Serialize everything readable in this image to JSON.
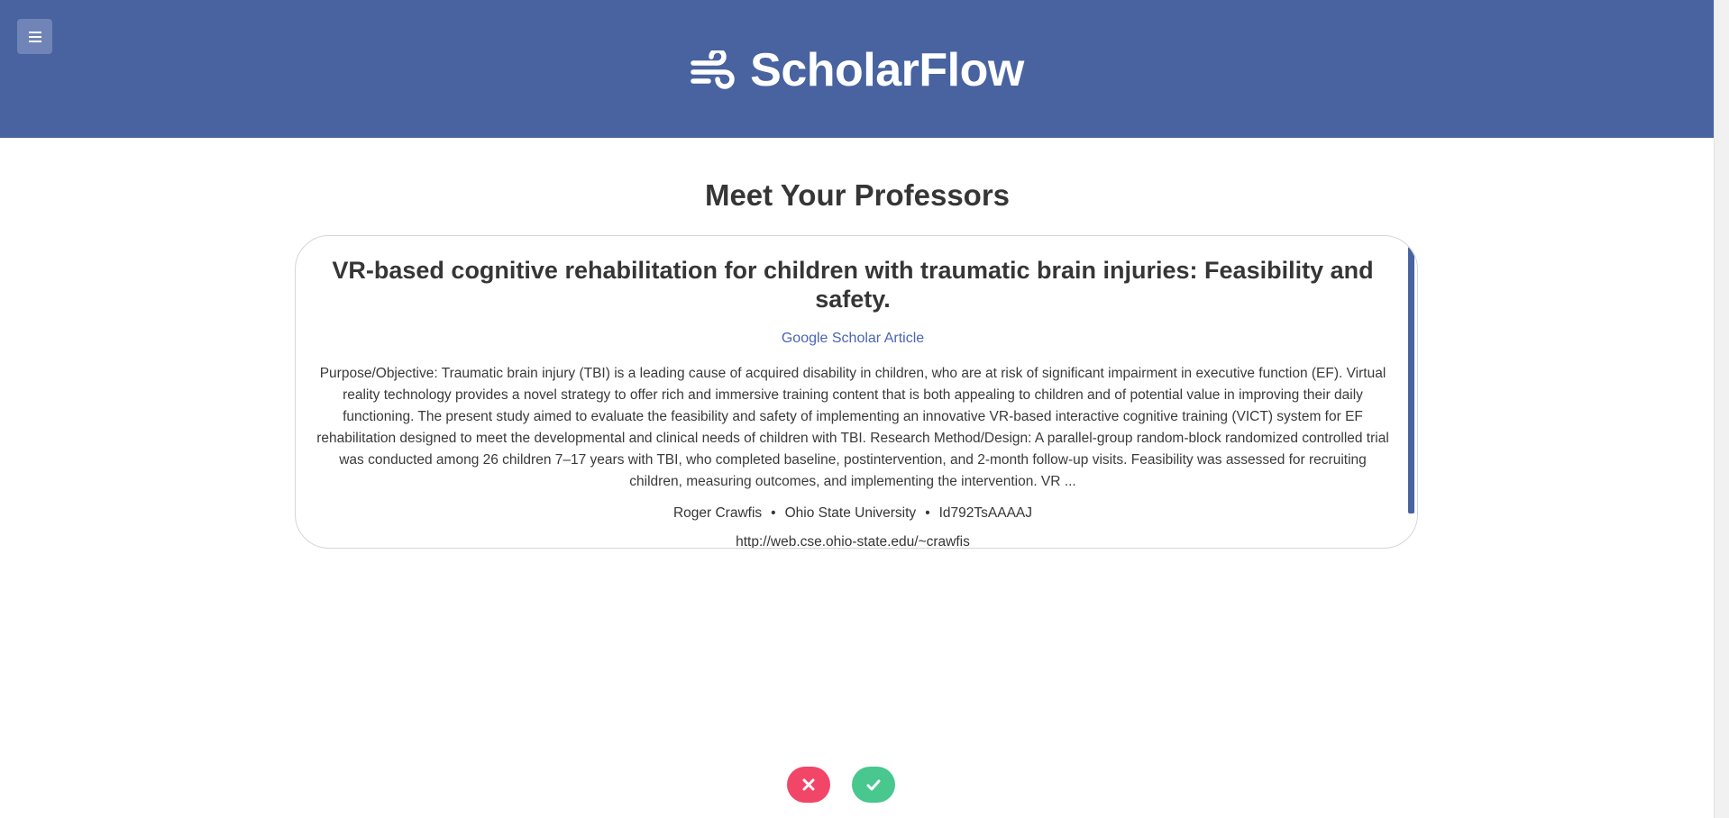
{
  "app": {
    "name": "ScholarFlow",
    "logo_icon": "wind-icon",
    "menu_icon": "hamburger-menu-icon",
    "header_color": "#4863a0"
  },
  "page": {
    "title": "Meet Your Professors"
  },
  "card": {
    "title": "VR-based cognitive rehabilitation for children with traumatic brain injuries: Feasibility and safety.",
    "link_label": "Google Scholar Article",
    "abstract": "Purpose/Objective: Traumatic brain injury (TBI) is a leading cause of acquired disability in children, who are at risk of significant impairment in executive function (EF). Virtual reality technology provides a novel strategy to offer rich and immersive training content that is both appealing to children and of potential value in improving their daily functioning. The present study aimed to evaluate the feasibility and safety of implementing an innovative VR-based interactive cognitive training (VICT) system for EF rehabilitation designed to meet the developmental and clinical needs of children with TBI. Research Method/Design: A parallel-group random-block randomized controlled trial was conducted among 26 children 7–17 years with TBI, who completed baseline, postintervention, and 2-month follow-up visits. Feasibility was assessed for recruiting children, measuring outcomes, and implementing the intervention. VR ...",
    "professor": "Roger Crawfis",
    "university": "Ohio State University",
    "scholar_id": "Id792TsAAAAJ",
    "separator": "•",
    "url_partial": "http://web.cse.ohio-state.edu/~crawfis"
  },
  "actions": {
    "reject_icon": "close-icon",
    "accept_icon": "checkmark-icon",
    "reject_color": "#f14668",
    "accept_color": "#48c78e"
  }
}
